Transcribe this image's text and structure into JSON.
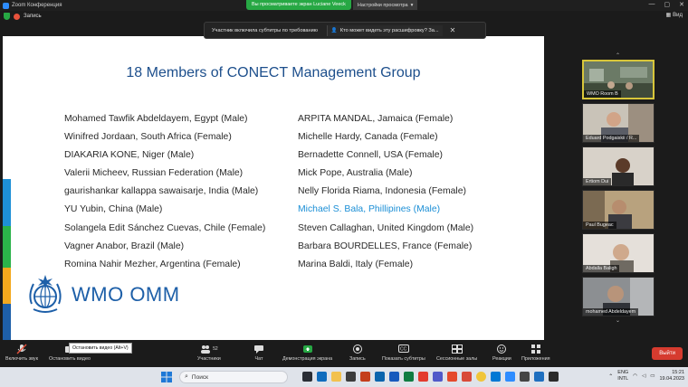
{
  "window": {
    "title": "Zoom Конференция",
    "controls": [
      "—",
      "▢",
      "✕"
    ]
  },
  "share_banner": {
    "viewing": "Вы просматриваете экран Luciane Veeck",
    "options": "Настройки просмотра"
  },
  "meeting": {
    "record_label": "Запись",
    "view_label": "Вид"
  },
  "captions": {
    "notice": "Участник включила субтитры по требованию",
    "who_can_see": "Кто может видеть эту расшифровку? За..."
  },
  "slide": {
    "title": "18 Members of CONECT Management Group",
    "left_column": [
      "Mohamed Tawfik Abdeldayem, Egypt (Male)",
      "Winifred Jordaan, South Africa (Female)",
      "DIAKARIA KONE, Niger (Male)",
      "Valerii Micheev, Russian Federation (Male)",
      "gaurishankar kallappa sawaisarje, India (Male)",
      "YU Yubin, China (Male)",
      "Solangela Edit Sánchez Cuevas, Chile (Female)",
      "Vagner Anabor, Brazil (Male)",
      "Romina Nahir Mezher, Argentina (Female)"
    ],
    "right_column": [
      "ARPITA MANDAL, Jamaica (Female)",
      "Michelle Hardy, Canada (Female)",
      "Bernadette Connell, USA (Female)",
      "Mick Pope, Australia (Male)",
      "Nelly Florida Riama, Indonesia (Female)",
      "Michael S. Bala, Phillipines (Male)",
      "Steven Callaghan, United Kingdom (Male)",
      "Barbara BOURDELLES, France (Female)",
      "Marina Baldi, Italy (Female)"
    ],
    "highlight_color": "#1c8fd6",
    "logo_text": "WMO OMM",
    "stripe_colors": [
      "#1e90d6",
      "#2bb34a",
      "#f4a81d",
      "#1e5fa8"
    ]
  },
  "participants": [
    {
      "name": "WMO Room B",
      "active": true
    },
    {
      "name": "Eduard Podgaiskii / R..."
    },
    {
      "name": "Ertiom Dui"
    },
    {
      "name": "Paul Bugeac"
    },
    {
      "name": "Abdalla Baligh"
    },
    {
      "name": "mohamed Abdeldayem"
    }
  ],
  "toolbar": {
    "mute": "Включить звук",
    "stop_video": "Остановить видео",
    "tooltip": "Остановить видео (Alt+V)",
    "participants": "Участники",
    "participants_count": "52",
    "chat": "Чат",
    "share_screen": "Демонстрация экрана",
    "record": "Запись",
    "captions": "Показать субтитры",
    "breakout": "Сессионные залы",
    "reactions": "Реакции",
    "apps": "Приложения",
    "leave": "Выйти"
  },
  "taskbar": {
    "search": "Поиск",
    "lang": "ENG",
    "layout": "INTL",
    "time": "15:21",
    "date": "19.04.2023"
  }
}
